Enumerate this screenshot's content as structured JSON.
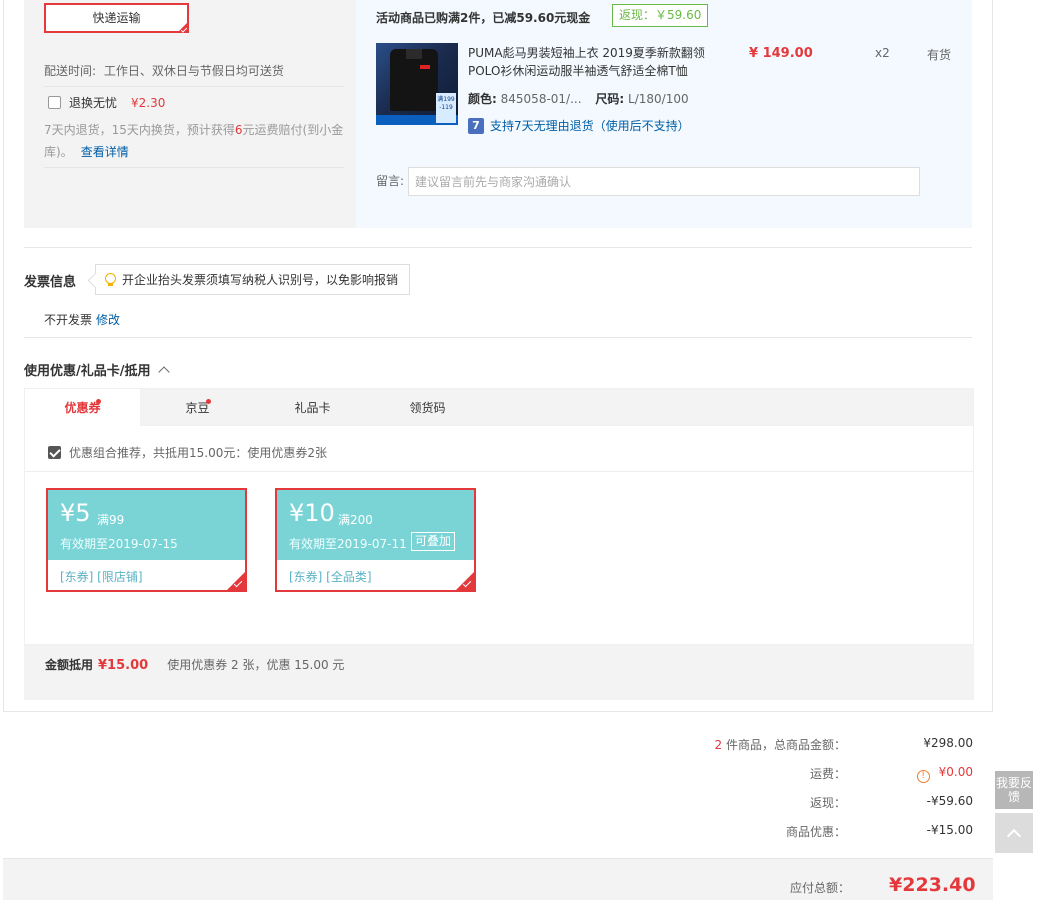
{
  "shipping": {
    "express_label": "快递运输",
    "delivery_time_label": "配送时间:",
    "delivery_time_value": "工作日、双休日与节假日均可送货",
    "return_label": "退换无忧",
    "return_price": "¥2.30",
    "return_desc_1": "7天内退货，15天内换货，预计获得",
    "return_desc_num": "6",
    "return_desc_2": "元运费赔付(到小金库)。",
    "return_link": "查看详情"
  },
  "promotion": {
    "title": "活动商品已购满2件，已减59.60元现金",
    "badge": "返现：￥59.60"
  },
  "product": {
    "name": "PUMA彪马男装短袖上衣 2019夏季新款翻领POLO衫休闲运动服半袖透气舒适全棉T恤",
    "price": "¥ 149.00",
    "qty": "x2",
    "stock": "有货",
    "color_label": "颜色:",
    "color_value": "845058-01/...",
    "size_label": "尺码:",
    "size_value": "L/180/100",
    "service_icon": "7",
    "service_text": "支持7天无理由退货（使用后不支持）",
    "img_tag": "满199 -119"
  },
  "remark": {
    "label": "留言:",
    "placeholder": "建议留言前先与商家沟通确认"
  },
  "invoice": {
    "title": "发票信息",
    "tip": "开企业抬头发票须填写纳税人识别号，以免影响报销",
    "value": "不开发票",
    "edit_link": "修改"
  },
  "coupon_section": {
    "title": "使用优惠/礼品卡/抵用",
    "tabs": [
      {
        "label": "优惠券",
        "dot": true
      },
      {
        "label": "京豆",
        "dot": true
      },
      {
        "label": "礼品卡",
        "dot": false
      },
      {
        "label": "领货码",
        "dot": false
      }
    ],
    "combo_text": "优惠组合推荐，共抵用15.00元：使用优惠券2张",
    "coupons": [
      {
        "amount": "¥5",
        "condition": "满99",
        "expiry": "有效期至2019-07-15",
        "tags": "[东券] [限店铺]",
        "stackable": ""
      },
      {
        "amount": "¥10",
        "condition": "满200",
        "expiry": "有效期至2019-07-11",
        "tags": "[东券] [全品类]",
        "stackable": "可叠加"
      }
    ],
    "summary_label": "金额抵用",
    "summary_amount": "¥15.00",
    "summary_desc": "使用优惠券 2 张，优惠 15.00 元"
  },
  "totals": {
    "count": "2",
    "goods_label": " 件商品，总商品金额：",
    "goods_value": "¥298.00",
    "shipping_label": "运费：",
    "shipping_value": "¥0.00",
    "cashback_label": "返现：",
    "cashback_value": "-¥59.60",
    "discount_label": "商品优惠：",
    "discount_value": "-¥15.00",
    "payable_label": "应付总额：",
    "payable_value": "¥223.40"
  },
  "floating": {
    "feedback": "我要反馈"
  },
  "colors": {
    "accent_red": "#e4393c",
    "link_blue": "#005ea7",
    "coupon_teal": "#7ad4d6",
    "cashback_green": "#69b946"
  }
}
